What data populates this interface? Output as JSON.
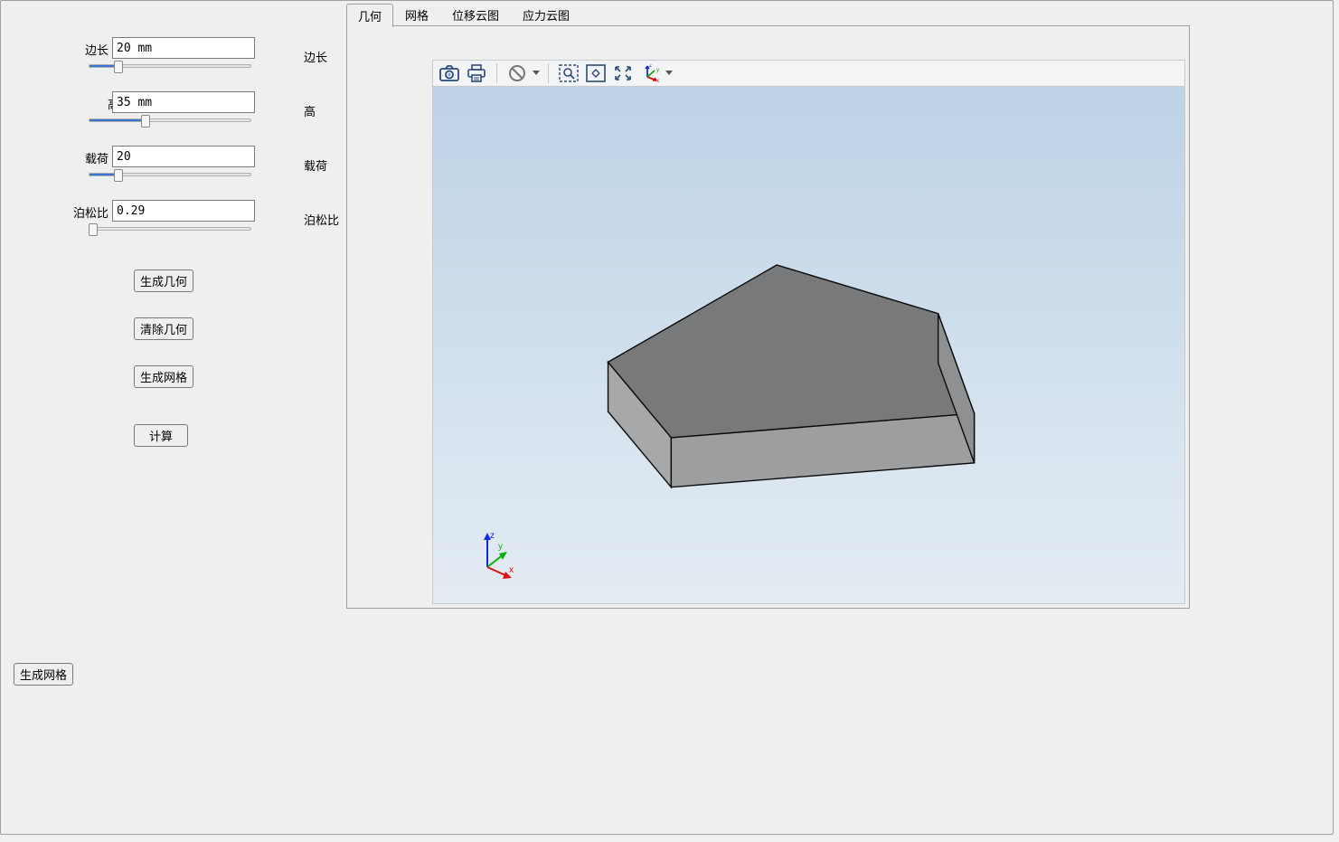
{
  "params": {
    "edge": {
      "label_left": "边长",
      "value": "20 mm",
      "label_right": "边长",
      "slider_pct": 18
    },
    "height": {
      "label_left": "高",
      "value": "35 mm",
      "label_right": "高",
      "slider_pct": 35
    },
    "load": {
      "label_left": "载荷",
      "value": "20",
      "label_right": "载荷",
      "slider_pct": 18
    },
    "poisson": {
      "label_left": "泊松比",
      "value": "0.29",
      "label_right": "泊松比",
      "slider_pct": 2
    }
  },
  "buttons": {
    "gen_geom": "生成几何",
    "clear_geom": "清除几何",
    "gen_mesh": "生成网格",
    "compute": "计算",
    "bottom_gen_mesh": "生成网格"
  },
  "tabs": {
    "geometry": "几何",
    "mesh": "网格",
    "disp_cloud": "位移云图",
    "stress_cloud": "应力云图",
    "active": "geometry"
  },
  "toolbar_icons": {
    "camera": "camera-icon",
    "print": "print-icon",
    "forbid": "no-entry-icon",
    "zoom_box": "zoom-box-icon",
    "fit": "fit-view-icon",
    "expand": "expand-arrows-icon",
    "axes": "axes-icon"
  },
  "axes_legend": {
    "x": "x",
    "y": "y",
    "z": "z"
  }
}
